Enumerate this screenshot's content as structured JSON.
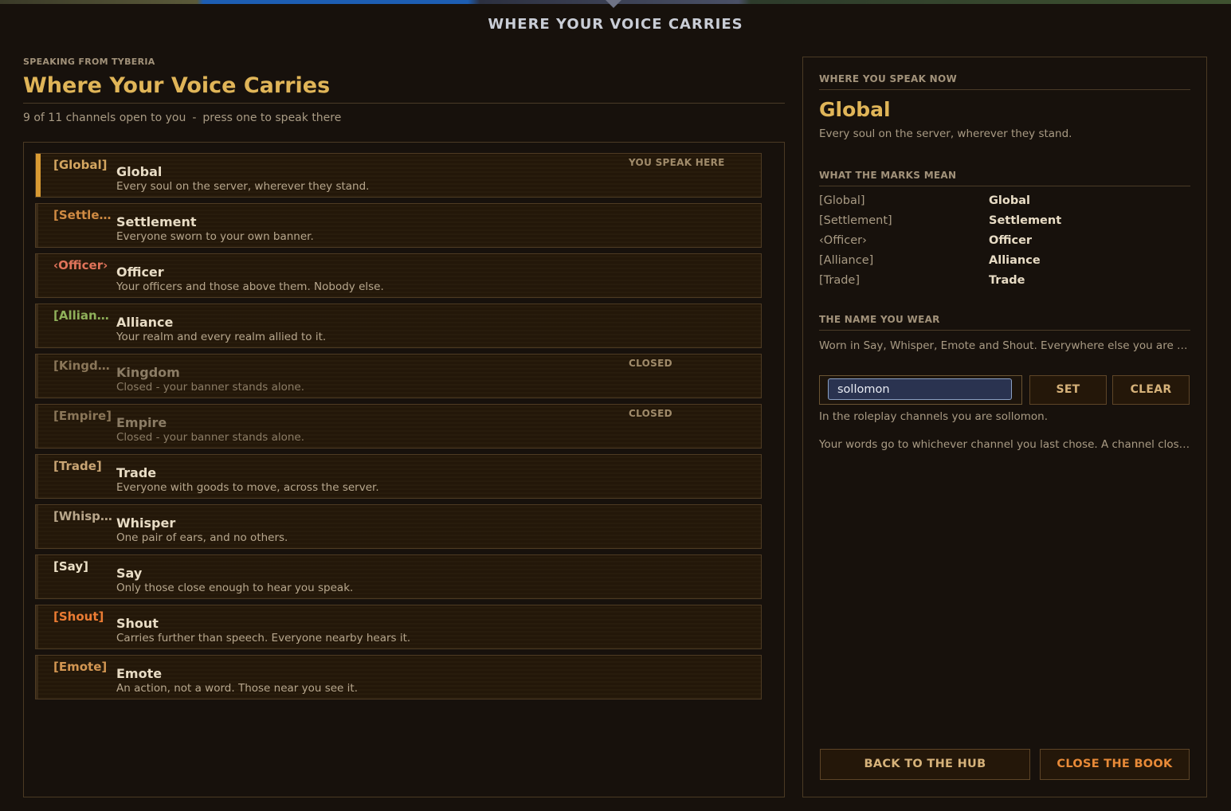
{
  "header": {
    "title": "WHERE YOUR VOICE CARRIES"
  },
  "left": {
    "eyebrow": "SPEAKING FROM TYBERIA",
    "title": "Where Your Voice Carries",
    "count_text": "9 of 11 channels open to you",
    "hint_text": "press one to speak there"
  },
  "channels": [
    {
      "tag": "[Global]",
      "name": "Global",
      "desc": "Every soul on the server, wherever they stand.",
      "state": "YOU SPEAK HERE",
      "tag_color": "#d4a660"
    },
    {
      "tag": "[Settlement]",
      "name": "Settlement",
      "desc": "Everyone sworn to your own banner.",
      "state": "",
      "tag_color": "#d08b43"
    },
    {
      "tag": "‹Officer›",
      "name": "Officer",
      "desc": "Your officers and those above them. Nobody else.",
      "state": "",
      "tag_color": "#e0735a"
    },
    {
      "tag": "[Alliance]",
      "name": "Alliance",
      "desc": "Your realm and every realm allied to it.",
      "state": "",
      "tag_color": "#8fb05a"
    },
    {
      "tag": "[Kingdom]",
      "name": "Kingdom",
      "desc": "Closed - your banner stands alone.",
      "state": "CLOSED",
      "tag_color": "#8a7658"
    },
    {
      "tag": "[Empire]",
      "name": "Empire",
      "desc": "Closed - your banner stands alone.",
      "state": "CLOSED",
      "tag_color": "#8a7658"
    },
    {
      "tag": "[Trade]",
      "name": "Trade",
      "desc": "Everyone with goods to move, across the server.",
      "state": "",
      "tag_color": "#c9a574"
    },
    {
      "tag": "[Whisper]",
      "name": "Whisper",
      "desc": "One pair of ears, and no others.",
      "state": "",
      "tag_color": "#b9a78b"
    },
    {
      "tag": "[Say]",
      "name": "Say",
      "desc": "Only those close enough to hear you speak.",
      "state": "",
      "tag_color": "#ece1c8"
    },
    {
      "tag": "[Shout]",
      "name": "Shout",
      "desc": "Carries further than speech. Everyone nearby hears it.",
      "state": "",
      "tag_color": "#ec7c33"
    },
    {
      "tag": "[Emote]",
      "name": "Emote",
      "desc": "An action, not a word. Those near you see it.",
      "state": "",
      "tag_color": "#d29652"
    }
  ],
  "right": {
    "now_header": "WHERE YOU SPEAK NOW",
    "now_name": "Global",
    "now_desc": "Every soul on the server, wherever they stand.",
    "marks_header": "WHAT THE MARKS MEAN",
    "marks": [
      {
        "mark": "[Global]",
        "meaning": "Global"
      },
      {
        "mark": "[Settlement]",
        "meaning": "Settlement"
      },
      {
        "mark": "‹Officer›",
        "meaning": "Officer"
      },
      {
        "mark": "[Alliance]",
        "meaning": "Alliance"
      },
      {
        "mark": "[Trade]",
        "meaning": "Trade"
      }
    ],
    "name_header": "THE NAME YOU WEAR",
    "name_note": "Worn in Say, Whisper, Emote and Shout. Everywhere else you are Sollo...",
    "name_value": "sollomon",
    "set_label": "SET",
    "clear_label": "CLEAR",
    "rp_note": "In the roleplay channels you are sollomon.",
    "routing_note": "Your words go to whichever channel you last chose. A channel closes w...",
    "back_label": "BACK TO THE HUB",
    "close_label": "CLOSE THE BOOK"
  },
  "colors": {
    "accent": "#e0b558",
    "active_bar": "#d89a33",
    "close_button": "#e88a38"
  }
}
